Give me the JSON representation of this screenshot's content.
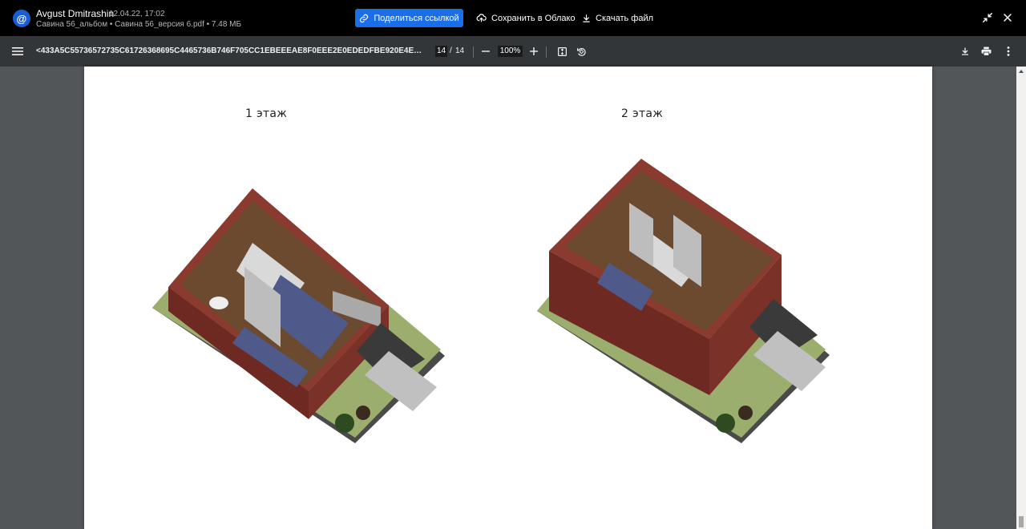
{
  "header": {
    "avatar_icon": "mail-at-icon",
    "author": "Avgust Dmitrashin",
    "date": "12.04.22, 17:02",
    "file_info": "Савина 56_альбом • Савина 56_версия 6.pdf • 7.48 МБ",
    "share_label": "Поделиться ссылкой",
    "save_cloud_label": "Сохранить в Облако",
    "download_label": "Скачать файл",
    "accent_color": "#1a6fe8"
  },
  "toolbar": {
    "title": "<433A5C55736572735C61726368695C4465736B746F705CC1EBEEEAE8F0EEE2E0EDEDFBE920E4EEEC5FD1FBE…",
    "current_page": "14",
    "page_separator": "/",
    "total_pages": "14",
    "zoom": "100%"
  },
  "page": {
    "floor1_label": "1 этаж",
    "floor2_label": "2 этаж"
  }
}
